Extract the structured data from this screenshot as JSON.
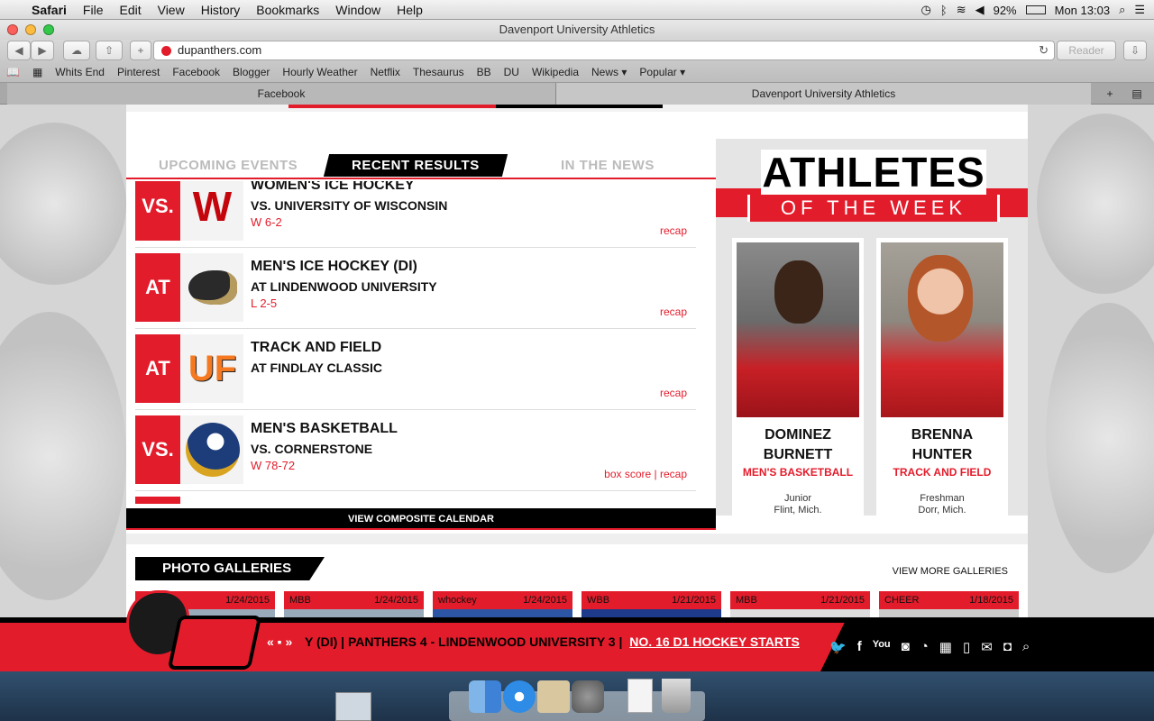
{
  "menubar": {
    "app": "Safari",
    "items": [
      "File",
      "Edit",
      "View",
      "History",
      "Bookmarks",
      "Window",
      "Help"
    ],
    "battery": "92%",
    "clock": "Mon 13:03"
  },
  "window": {
    "title": "Davenport University Athletics",
    "url": "dupanthers.com",
    "reader": "Reader"
  },
  "favorites": [
    "Whits End",
    "Pinterest",
    "Facebook",
    "Blogger",
    "Hourly Weather",
    "Netflix",
    "Thesaurus",
    "BB",
    "DU",
    "Wikipedia",
    "News ▾",
    "Popular ▾"
  ],
  "tabs": [
    "Facebook",
    "Davenport University Athletics"
  ],
  "event_tabs": {
    "upcoming": "UPCOMING EVENTS",
    "recent": "RECENT RESULTS",
    "news": "IN THE NEWS"
  },
  "results": [
    {
      "badge": "VS.",
      "sport": "WOMEN'S ICE HOCKEY",
      "opponent": "VS. UNIVERSITY OF WISCONSIN",
      "score": "W 6-2",
      "links": "recap"
    },
    {
      "badge": "AT",
      "sport": "MEN'S ICE HOCKEY (DI)",
      "opponent": "AT LINDENWOOD UNIVERSITY",
      "score": "L 2-5",
      "links": "recap"
    },
    {
      "badge": "AT",
      "sport": "TRACK AND FIELD",
      "opponent": "AT FINDLAY CLASSIC",
      "score": "",
      "links": "recap"
    },
    {
      "badge": "VS.",
      "sport": "MEN'S BASKETBALL",
      "opponent": "VS. CORNERSTONE",
      "score": "W 78-72",
      "links": "box score | recap"
    }
  ],
  "calendar_link": "VIEW COMPOSITE CALENDAR",
  "aotw": {
    "title": "ATHLETES",
    "subtitle": "OF THE WEEK",
    "athletes": [
      {
        "first": "DOMINEZ",
        "last": "BURNETT",
        "sport": "MEN'S BASKETBALL",
        "year": "Junior",
        "home": "Flint, Mich."
      },
      {
        "first": "BRENNA",
        "last": "HUNTER",
        "sport": "TRACK AND FIELD",
        "year": "Freshman",
        "home": "Dorr, Mich."
      }
    ]
  },
  "galleries": {
    "title": "PHOTO GALLERIES",
    "more": "VIEW MORE GALLERIES",
    "items": [
      {
        "label": "",
        "date": "1/24/2015"
      },
      {
        "label": "MBB",
        "date": "1/24/2015"
      },
      {
        "label": "whockey",
        "date": "1/24/2015"
      },
      {
        "label": "WBB",
        "date": "1/21/2015"
      },
      {
        "label": "MBB",
        "date": "1/21/2015"
      },
      {
        "label": "CHEER",
        "date": "1/18/2015"
      }
    ]
  },
  "ticker": {
    "controls": "« ▪ »",
    "text": "Y (DI) | PANTHERS 4 - LINDENWOOD UNIVERSITY 3 |",
    "highlight": "NO. 16 D1 HOCKEY STARTS"
  },
  "colors": {
    "brand_red": "#e31c2b",
    "black": "#000000"
  }
}
